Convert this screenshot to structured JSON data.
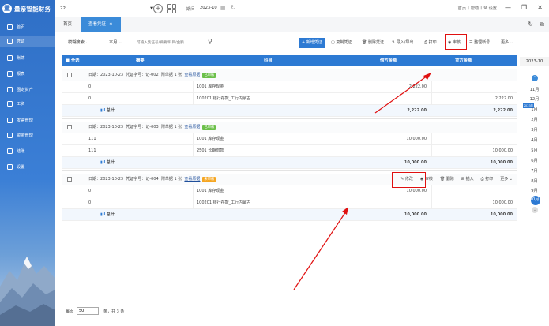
{
  "app": {
    "logo_text": "量亲智能财务"
  },
  "sidebar": {
    "items": [
      {
        "label": "首页"
      },
      {
        "label": "凭证"
      },
      {
        "label": "账簿"
      },
      {
        "label": "报表"
      },
      {
        "label": "固定资产"
      },
      {
        "label": "工资"
      },
      {
        "label": "发票管理"
      },
      {
        "label": "资金管理"
      },
      {
        "label": "结账"
      },
      {
        "label": "设置"
      }
    ]
  },
  "topbar": {
    "account_id": "22",
    "period_label": "期间",
    "period_value": "2023-10",
    "links": [
      "首页",
      "帮助",
      "设置"
    ]
  },
  "tabs": [
    {
      "label": "首页"
    },
    {
      "label": "查看凭证"
    }
  ],
  "toolbar": {
    "search_type": "模糊搜索",
    "scope": "本月",
    "search_placeholder": "可输入凭证号/摘要/科目/金额...",
    "buttons": {
      "new": "+ 新增凭证",
      "copy": "复制凭证",
      "delete": "删除凭证",
      "import": "导入/导出",
      "print": "打印",
      "audit": "审核",
      "reorder": "整理断号",
      "more": "更多"
    }
  },
  "table": {
    "headers": {
      "select_all": "全选",
      "summary": "摘要",
      "subject": "科目",
      "debit": "借方金额",
      "credit": "贷方金额"
    },
    "meta_labels": {
      "date": "日期：",
      "voucher_no": "凭证字号：",
      "attachments": "附单据",
      "view_source": "查看原据"
    },
    "total_label": "总计",
    "row_actions": {
      "edit": "修改",
      "audit": "审核",
      "delete": "删除",
      "insert": "插入",
      "print": "打印",
      "more": "更多"
    },
    "vouchers": [
      {
        "date": "2023-10-23",
        "no": "记-002",
        "attach": "1 张",
        "status": "已审核",
        "status_color": "#6cc04a",
        "rows": [
          {
            "summary": "0",
            "subject": "1001 库存现金",
            "debit": "2,222.00",
            "credit": ""
          },
          {
            "summary": "0",
            "subject": "100201 银行存款_工行内蒙古",
            "debit": "",
            "credit": "2,222.00"
          }
        ],
        "total_debit": "2,222.00",
        "total_credit": "2,222.00"
      },
      {
        "date": "2023-10-23",
        "no": "记-003",
        "attach": "1 张",
        "status": "已审核",
        "status_color": "#6cc04a",
        "rows": [
          {
            "summary": "111",
            "subject": "1001 库存现金",
            "debit": "10,000.00",
            "credit": ""
          },
          {
            "summary": "111",
            "subject": "2501 长期借款",
            "debit": "",
            "credit": "10,000.00"
          }
        ],
        "total_debit": "10,000.00",
        "total_credit": "10,000.00"
      },
      {
        "date": "2023-10-23",
        "no": "记-004",
        "attach": "1 张",
        "status": "未审核",
        "status_color": "#f5a623",
        "rows": [
          {
            "summary": "0",
            "subject": "1001 库存现金",
            "debit": "10,000.00",
            "credit": ""
          },
          {
            "summary": "0",
            "subject": "100201 银行存款_工行内蒙古",
            "debit": "",
            "credit": "10,000.00"
          }
        ],
        "total_debit": "10,000.00",
        "total_credit": "10,000.00"
      }
    ]
  },
  "calendar": {
    "year": "2023-10",
    "flag": "2023年",
    "months": [
      "11月",
      "12月",
      "1月",
      "2月",
      "3月",
      "4月",
      "5月",
      "6月",
      "7月",
      "8月",
      "9月",
      "10月"
    ],
    "selected": "10月"
  },
  "footer": {
    "per_page_label": "每页",
    "per_page_value": "50",
    "summary": "条，共 3 条"
  }
}
